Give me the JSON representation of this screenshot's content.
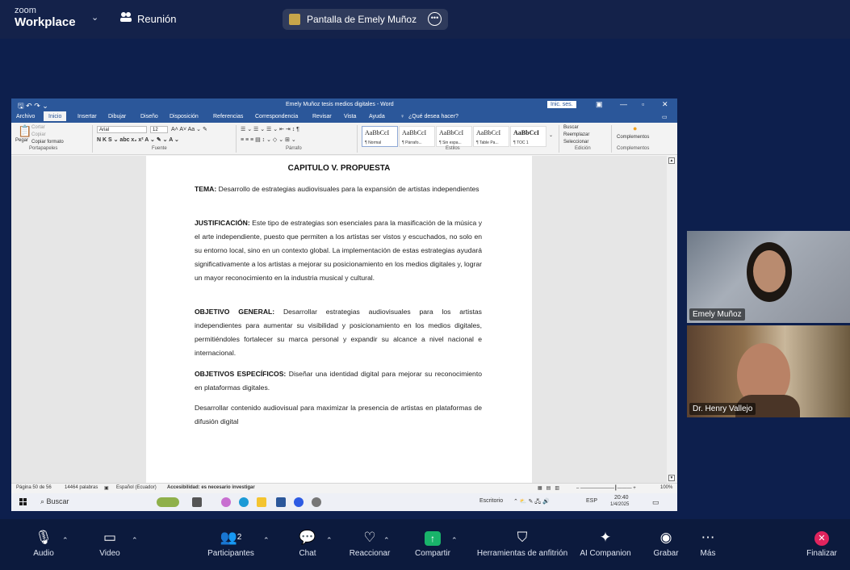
{
  "zoom": {
    "logo_line1": "zoom",
    "logo_line2": "Workplace",
    "chevron": "⌄",
    "meeting_label": "Reunión",
    "share_title": "Pantalla de Emely Muñoz"
  },
  "word": {
    "window_title": "Emely Muñoz tesis medios digitales - Word",
    "signin": "Inic. ses.",
    "tabs": [
      "Archivo",
      "Inicio",
      "Insertar",
      "Dibujar",
      "Diseño",
      "Disposición",
      "Referencias",
      "Correspondencia",
      "Revisar",
      "Vista",
      "Ayuda"
    ],
    "tell_me": "¿Qué desea hacer?",
    "clipboard": {
      "cut": "Cortar",
      "copy": "Copiar",
      "paste": "Pegar",
      "format_painter": "Copiar formato",
      "group": "Portapapeles"
    },
    "font": {
      "name": "Arial",
      "size": "12",
      "group": "Fuente"
    },
    "paragraph_group": "Párrafo",
    "styles": [
      {
        "preview": "AaBbCcI",
        "name": "¶ Normal"
      },
      {
        "preview": "AaBbCcI",
        "name": "¶ Párrafo..."
      },
      {
        "preview": "AaBbCcI",
        "name": "¶ Sin espa..."
      },
      {
        "preview": "AaBbCcI",
        "name": "¶ Table Pa..."
      },
      {
        "preview": "AaBbCcI",
        "name": "¶ TOC 1"
      }
    ],
    "styles_group": "Estilos",
    "editing": {
      "find": "Buscar",
      "replace": "Reemplazar",
      "select": "Seleccionar",
      "group": "Edición"
    },
    "addins": {
      "label": "Complementos",
      "group": "Complementos"
    },
    "document": {
      "heading": "CAPITULO V. PROPUESTA",
      "p1_label": "TEMA:",
      "p1_text": " Desarrollo de estrategias audiovisuales para la expansión de artistas independientes",
      "p2_label": "JUSTIFICACIÓN:",
      "p2_text": " Este tipo de estrategias son esenciales para la masificación de la música y el arte independiente, puesto que permiten a los artistas ser vistos y escuchados, no solo en su entorno local, sino en un contexto global. La implementación de estas estrategias ayudará significativamente a los artistas a mejorar su posicionamiento en los medios digitales y, lograr un mayor reconocimiento en la industria musical y cultural.",
      "p3_label": "OBJETIVO GENERAL:",
      "p3_text": " Desarrollar estrategias audiovisuales para los artistas independientes para aumentar su visibilidad y posicionamiento en los medios digitales, permitiéndoles fortalecer su marca personal y expandir su alcance a nivel nacional e internacional.",
      "p4_label": "OBJETIVOS ESPECÍFICOS:",
      "p4_text": " Diseñar una identidad digital para mejorar su reconocimiento en plataformas digitales.",
      "p5_text": "Desarrollar contenido audiovisual para maximizar la presencia de artistas en plataformas de difusión digital"
    },
    "status": {
      "page": "Página 50 de 56",
      "words": "14464 palabras",
      "language": "Español (Ecuador)",
      "accessibility": "Accesibilidad: es necesario investigar",
      "zoom": "100%"
    }
  },
  "taskbar": {
    "search": "Buscar",
    "desktop": "Escritorio",
    "lang": "ESP",
    "time": "20:40",
    "date": "1/4/2025"
  },
  "participants": [
    {
      "name": "Emely Muñoz"
    },
    {
      "name": "Dr. Henry Vallejo"
    }
  ],
  "controls": {
    "audio": "Audio",
    "video": "Video",
    "participants": "Participantes",
    "participants_count": "2",
    "chat": "Chat",
    "react": "Reaccionar",
    "share": "Compartir",
    "host_tools": "Herramientas de anfitrión",
    "ai": "AI Companion",
    "record": "Grabar",
    "more": "Más",
    "end": "Finalizar"
  },
  "colors": {
    "zoom_bg": "#0c1a3d",
    "word_blue": "#2b579a",
    "share_green": "#19b36a",
    "end_red": "#e0245e"
  }
}
